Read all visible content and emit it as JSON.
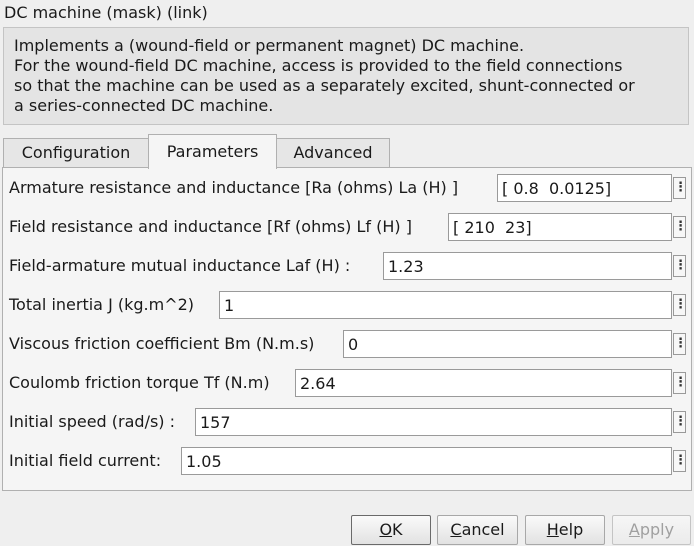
{
  "window": {
    "title": "DC machine (mask) (link)"
  },
  "description": {
    "lines": [
      "Implements a (wound-field or permanent magnet) DC machine.",
      "For the wound-field DC machine, access is provided to the field connections",
      "so that the machine can be used as a separately excited, shunt-connected or",
      "a series-connected  DC machine."
    ]
  },
  "tabs": [
    {
      "label": "Configuration",
      "active": false
    },
    {
      "label": "Parameters",
      "active": true
    },
    {
      "label": "Advanced",
      "active": false
    }
  ],
  "parameters": [
    {
      "label": "Armature resistance and inductance [Ra (ohms) La (H) ]",
      "value": "[ 0.8  0.0125]"
    },
    {
      "label": "Field resistance and inductance [Rf (ohms) Lf (H) ]",
      "value": "[ 210  23]"
    },
    {
      "label": "Field-armature mutual inductance Laf (H) :",
      "value": "1.23"
    },
    {
      "label": "Total inertia J (kg.m^2)",
      "value": "1"
    },
    {
      "label": "Viscous friction coefficient Bm (N.m.s)",
      "value": "0"
    },
    {
      "label": "Coulomb friction torque Tf (N.m)",
      "value": "2.64"
    },
    {
      "label": "Initial speed (rad/s) :",
      "value": "157"
    },
    {
      "label": "Initial field current:",
      "value": "1.05"
    }
  ],
  "menu_glyph": "⋮",
  "buttons": {
    "ok": {
      "mnemonic": "O",
      "rest": "K",
      "enabled": true
    },
    "cancel": {
      "mnemonic": "C",
      "rest": "ancel",
      "enabled": true
    },
    "help": {
      "mnemonic": "H",
      "rest": "elp",
      "enabled": true
    },
    "apply": {
      "mnemonic": "A",
      "rest": "pply",
      "enabled": false
    }
  }
}
